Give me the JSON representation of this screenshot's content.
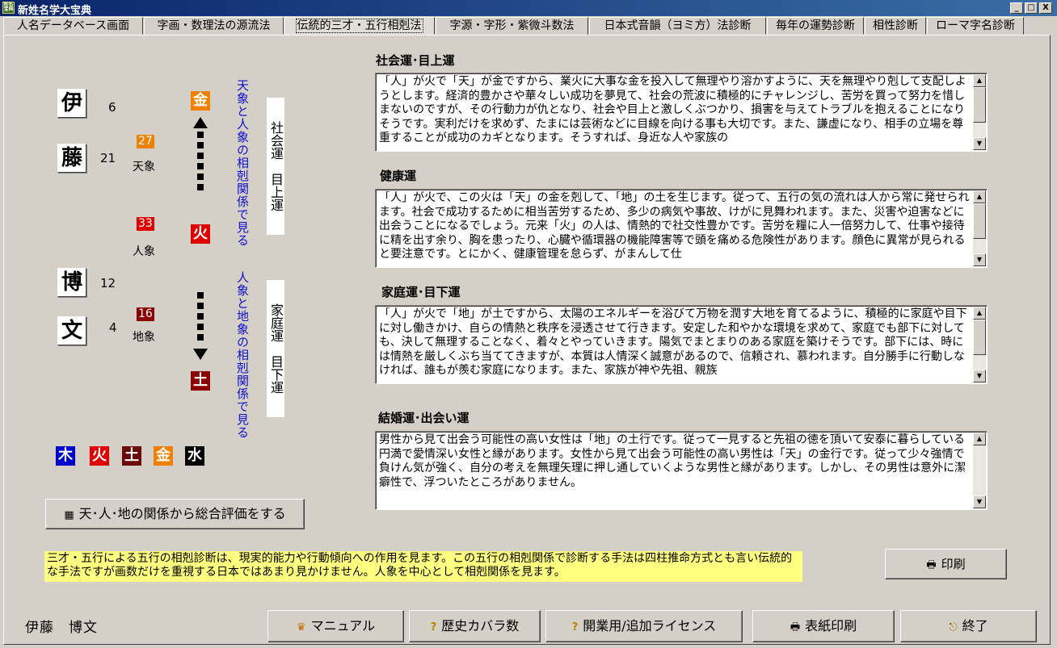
{
  "window": {
    "title": "新姓名学大宝典",
    "icon_text": "姓名宝典",
    "controls": {
      "minimize": "_",
      "maximize": "□",
      "close": "X"
    }
  },
  "tabs": [
    "人名データベース画面",
    "字画・数理法の源流法",
    "伝統的三才・五行相剋法",
    "字源・字形・紫微斗数法",
    "日本式音韻（ヨミ方）法診断",
    "毎年の運勢診断",
    "相性診断",
    "ローマ字名診断"
  ],
  "name_chars": [
    {
      "char": "伊",
      "strokes": "6"
    },
    {
      "char": "藤",
      "strokes": "21"
    },
    {
      "char": "博",
      "strokes": "12"
    },
    {
      "char": "文",
      "strokes": "4"
    }
  ],
  "sancai": {
    "ten": {
      "number": "27",
      "label": "天象",
      "color": "#f08000"
    },
    "jin": {
      "number": "33",
      "label": "人象",
      "color": "#e00000"
    },
    "chi": {
      "number": "16",
      "label": "地象",
      "color": "#8b0000"
    }
  },
  "elements_column": [
    {
      "char": "金",
      "color": "#f08000"
    },
    {
      "char": "火",
      "color": "#e00000"
    },
    {
      "char": "土",
      "color": "#8b0000"
    }
  ],
  "blue_texts": {
    "upper": "天象と人象の相剋関係で見る",
    "lower": "人象と地象の相剋関係で見る"
  },
  "vertical_boxes": {
    "upper": "社会運　目上運",
    "lower": "家庭運　目下運"
  },
  "legend": [
    {
      "char": "木",
      "color": "#0000cc"
    },
    {
      "char": "火",
      "color": "#e00000"
    },
    {
      "char": "土",
      "color": "#6b0a0a"
    },
    {
      "char": "金",
      "color": "#f08000"
    },
    {
      "char": "水",
      "color": "#000000"
    }
  ],
  "sections": [
    {
      "title": "社会運･目上運",
      "text": "「人」が火で「天」が金ですから、業火に大事な金を投入して無理やり溶かすように、天を無理やり剋して支配しようとします。経済的豊かさや華々しい成功を夢見て、社会の荒波に積極的にチャレンジし、苦労を買って努力を惜しまないのですが、その行動力が仇となり、社会や目上と激しくぶつかり、損害を与えてトラブルを抱えることになりそうです。実利だけを求めず、たまには芸術などに目線を向ける事も大切です。また、謙虚になり、相手の立場を尊重することが成功のカギとなります。そうすれば、身近な人や家族の"
    },
    {
      "title": "健康運",
      "text": "「人」が火で、この火は「天」の金を剋して、「地」の土を生じます。従って、五行の気の流れは人から常に発せられます。社会で成功するために相当苦労するため、多少の病気や事故、けがに見舞われます。また、災害や迫害などに出会うことになるでしょう。元来「火」の人は、情熱的で社交性豊かです。苦労を糧に人一倍努力して、仕事や接待に精を出す余り、胸を患ったり、心臓や循環器の機能障害等で頭を痛める危険性があります。顔色に異常が見られると要注意です。とにかく、健康管理を怠らず、がまんして仕"
    },
    {
      "title": "家庭運･目下運",
      "text": "「人」が火で「地」が土ですから、太陽のエネルギーを浴びて万物を潤す大地を育てるように、積極的に家庭や目下に対し働きかけ、自らの情熱と秩序を浸透させて行きます。安定した和やかな環境を求めて、家庭でも部下に対しても、決して無理することなく、着々とやっていきます。陽気でまとまりのある家庭を築けそうです。部下には、時には情熱を厳しくぶち当ててきますが、本質は人情深く誠意があるので、信頼され、慕われます。自分勝手に行動しなければ、誰もが羨む家庭になります。また、家族が神や先祖、親族"
    },
    {
      "title": "結婚運･出会い運",
      "text": "男性から見て出会う可能性の高い女性は「地」の土行です。従って一見すると先祖の徳を頂いて安泰に暮らしている円満で愛情深い女性と縁があります。女性から見て出会う可能性の高い男性は「天」の金行です。従って少々強情で負けん気が強く、自分の考えを無理矢理に押し通していくような男性と縁があります。しかし、その男性は意外に潔癖性で、浮ついたところがありません。"
    }
  ],
  "buttons": {
    "evaluate": "天･人･地の関係から総合評価をする",
    "print": "印刷",
    "manual": "マニュアル",
    "history": "歴史カバラ数",
    "license": "開業用/追加ライセンス",
    "cover_print": "表紙印刷",
    "exit": "終了"
  },
  "note": "三才・五行による五行の相剋診断は、現実的能力や行動傾向への作用を見ます。この五行の相剋関係で診断する手法は四柱推命方式とも言い伝統的な手法ですが画数だけを重視する日本ではあまり見かけません。人象を中心として相剋関係を見ます。",
  "full_name": "伊藤　博文"
}
